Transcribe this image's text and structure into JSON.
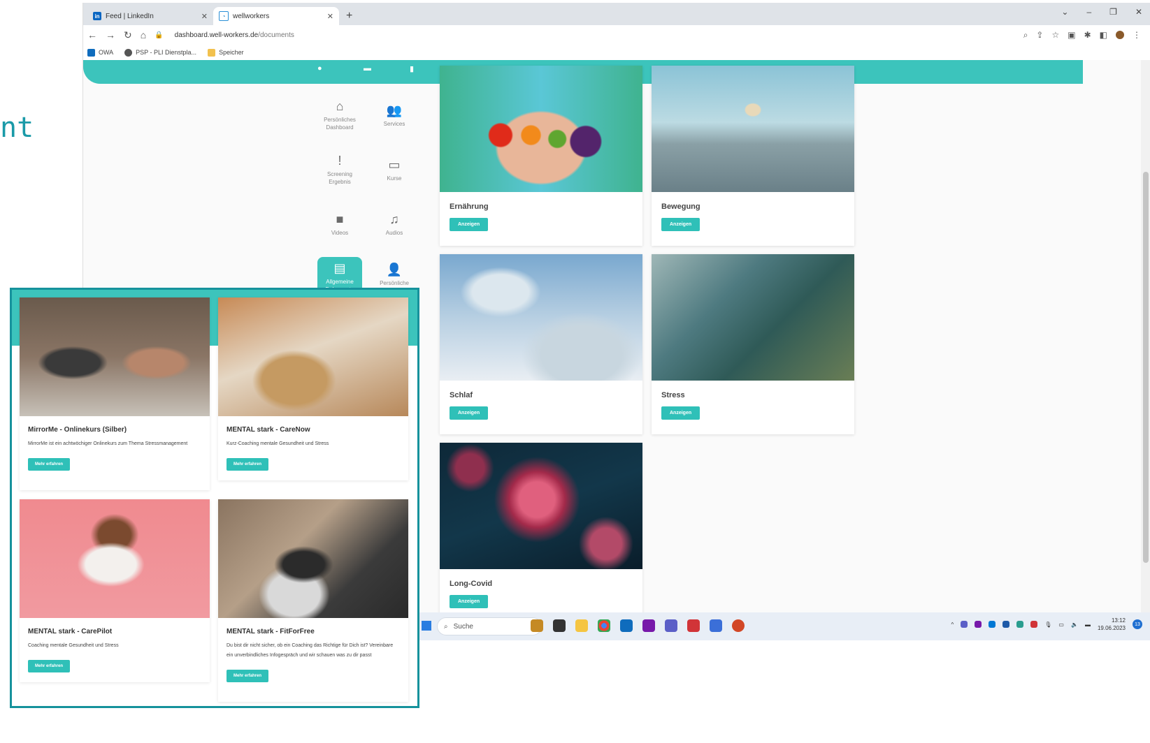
{
  "slide_fragment": "nt",
  "browser": {
    "tabs": [
      {
        "title": "Feed | LinkedIn",
        "icon": "linkedin-icon",
        "active": false
      },
      {
        "title": "wellworkers",
        "icon": "wellworkers-icon",
        "active": true
      }
    ],
    "url_domain": "dashboard.well-workers.de",
    "url_path": "/documents",
    "bookmarks": [
      "OWA",
      "PSP - PLI Dienstpla...",
      "Speicher"
    ]
  },
  "sidebar": {
    "items": [
      {
        "label": "Persönliches Dashboard",
        "icon": "home-icon"
      },
      {
        "label": "Services",
        "icon": "users-icon"
      },
      {
        "label": "Screening Ergebnis",
        "icon": "exclamation-icon"
      },
      {
        "label": "Kurse",
        "icon": "presentation-icon"
      },
      {
        "label": "Videos",
        "icon": "video-icon"
      },
      {
        "label": "Audios",
        "icon": "music-icon"
      },
      {
        "label": "Allgemeine Dokumente",
        "icon": "document-icon",
        "active": true
      },
      {
        "label": "Persönliche Dokumente",
        "icon": "user-edit-icon"
      }
    ]
  },
  "cards": [
    {
      "title": "Ernährung",
      "button": "Anzeigen"
    },
    {
      "title": "Bewegung",
      "button": "Anzeigen"
    },
    {
      "title": "Schlaf",
      "button": "Anzeigen"
    },
    {
      "title": "Stress",
      "button": "Anzeigen"
    },
    {
      "title": "Long-Covid",
      "button": "Anzeigen"
    }
  ],
  "taskbar": {
    "search_placeholder": "Suche",
    "time": "13:12",
    "date": "19.06.2023",
    "notification_count": "13"
  },
  "overlay": {
    "cards": [
      {
        "title": "MirrorMe - Onlinekurs (Silber)",
        "desc": "MirrorMe ist ein achtwöchiger Onlinekurs zum Thema Stressmanagement",
        "button": "Mehr erfahren"
      },
      {
        "title": "MENTAL stark - CareNow",
        "desc": "Kurz-Coaching mentale Gesundheit und Stress",
        "button": "Mehr erfahren"
      },
      {
        "title": "MENTAL stark - CarePilot",
        "desc": "Coaching mentale Gesundheit und Stress",
        "button": "Mehr erfahren"
      },
      {
        "title": "MENTAL stark - FitForFree",
        "desc": "Du bist dir nicht sicher, ob ein Coaching das Richtige für Dich ist? Vereinbare ein unverbindliches Infogespräch und wir schauen was zu dir passt",
        "button": "Mehr erfahren"
      }
    ]
  },
  "colors": {
    "accent": "#3cc4bc",
    "overlay_border": "#16929c"
  }
}
